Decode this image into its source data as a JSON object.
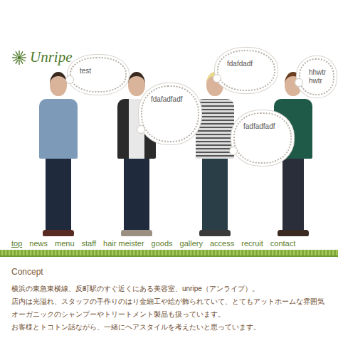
{
  "logo": {
    "text": "Unripe"
  },
  "staff": [
    {
      "bubble": "test"
    },
    {
      "bubble": "fdafadfadf"
    },
    {
      "bubble": "fdafdadf"
    },
    {
      "bubble": "fadfadfadf"
    },
    {
      "bubble": "hhwtrhwtr"
    }
  ],
  "nav": [
    {
      "label": "top",
      "selected": true
    },
    {
      "label": "news",
      "selected": false
    },
    {
      "label": "menu",
      "selected": false
    },
    {
      "label": "staff",
      "selected": false
    },
    {
      "label": "hair meister",
      "selected": false
    },
    {
      "label": "goods",
      "selected": false
    },
    {
      "label": "gallery",
      "selected": false
    },
    {
      "label": "access",
      "selected": false
    },
    {
      "label": "recruit",
      "selected": false
    },
    {
      "label": "contact",
      "selected": false
    }
  ],
  "concept": {
    "title": "Concept",
    "lines": [
      "横浜の東急東横線、反町駅のすぐ近くにある美容室、unripe（アンライプ）。",
      "店内は光溢れ、スタッフの手作りのはり金細工や絵が飾られていて、とてもアットホームな雰囲気",
      "オーガニックのシャンプーやトリートメント製品も扱っています。",
      "お客様とトコトン話ながら、一緒にヘアスタイルを考えたいと思っています。"
    ]
  }
}
